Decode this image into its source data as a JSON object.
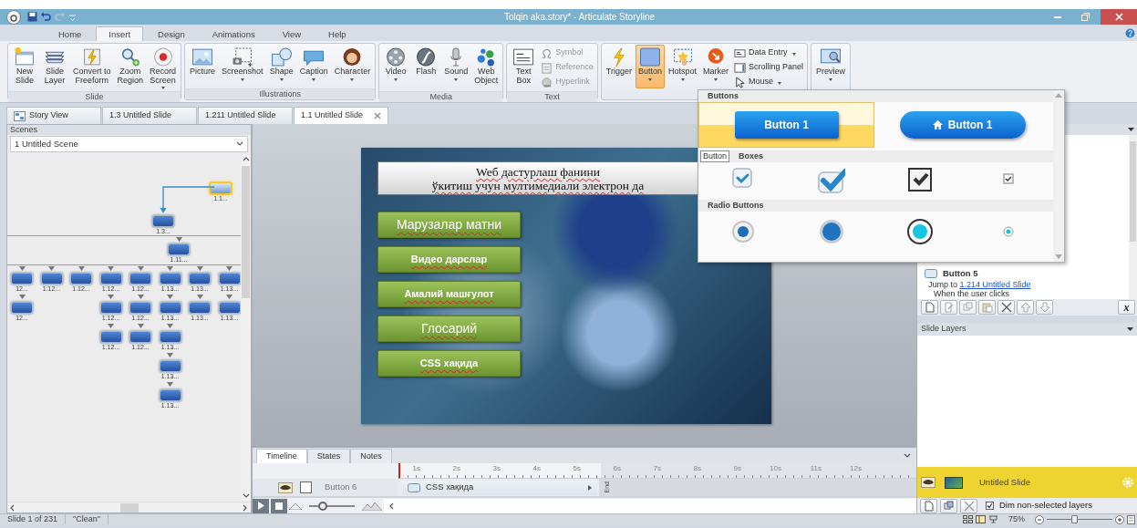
{
  "window": {
    "title": "Tolqin aka.story* - Articulate Storyline"
  },
  "menu_tabs": [
    {
      "label": "Home",
      "selected": false
    },
    {
      "label": "Insert",
      "selected": true
    },
    {
      "label": "Design",
      "selected": false
    },
    {
      "label": "Animations",
      "selected": false
    },
    {
      "label": "View",
      "selected": false
    },
    {
      "label": "Help",
      "selected": false
    }
  ],
  "ribbon_groups": [
    {
      "label": "Slide",
      "items": [
        {
          "kind": "large",
          "label": "New\nSlide",
          "dropdown": false,
          "selected": false,
          "disabled": false
        },
        {
          "kind": "large",
          "label": "Slide\nLayer",
          "dropdown": false,
          "selected": false,
          "disabled": false
        },
        {
          "kind": "large",
          "label": "Convert to\nFreeform",
          "dropdown": false,
          "selected": false,
          "disabled": false
        },
        {
          "kind": "large",
          "label": "Zoom\nRegion",
          "dropdown": false,
          "selected": false,
          "disabled": false
        },
        {
          "kind": "large",
          "label": "Record\nScreen",
          "dropdown": true,
          "selected": false,
          "disabled": false
        }
      ]
    },
    {
      "label": "Illustrations",
      "items": [
        {
          "kind": "large",
          "label": "Picture",
          "dropdown": false,
          "selected": false,
          "disabled": false
        },
        {
          "kind": "large",
          "label": "Screenshot",
          "dropdown": true,
          "selected": false,
          "disabled": false
        },
        {
          "kind": "large",
          "label": "Shape",
          "dropdown": true,
          "selected": false,
          "disabled": false
        },
        {
          "kind": "large",
          "label": "Caption",
          "dropdown": true,
          "selected": false,
          "disabled": false
        },
        {
          "kind": "large",
          "label": "Character",
          "dropdown": true,
          "selected": false,
          "disabled": false
        }
      ]
    },
    {
      "label": "Media",
      "items": [
        {
          "kind": "large",
          "label": "Video",
          "dropdown": true,
          "selected": false,
          "disabled": false
        },
        {
          "kind": "large",
          "label": "Flash",
          "dropdown": false,
          "selected": false,
          "disabled": false
        },
        {
          "kind": "large",
          "label": "Sound",
          "dropdown": true,
          "selected": false,
          "disabled": false
        },
        {
          "kind": "large",
          "label": "Web\nObject",
          "dropdown": false,
          "selected": false,
          "disabled": false
        }
      ]
    },
    {
      "label": "Text",
      "items": [
        {
          "kind": "large",
          "label": "Text\nBox",
          "dropdown": false,
          "selected": false,
          "disabled": false
        },
        {
          "kind": "small",
          "label": "Symbol",
          "dropdown": false,
          "selected": false,
          "disabled": true
        },
        {
          "kind": "small",
          "label": "Reference",
          "dropdown": false,
          "selected": false,
          "disabled": true
        },
        {
          "kind": "small",
          "label": "Hyperlink",
          "dropdown": false,
          "selected": false,
          "disabled": true
        }
      ]
    },
    {
      "items": [
        {
          "kind": "large",
          "label": "Trigger",
          "dropdown": false,
          "selected": false,
          "disabled": false
        },
        {
          "kind": "large",
          "label": "Button",
          "dropdown": true,
          "selected": true,
          "disabled": false
        },
        {
          "kind": "large",
          "label": "Hotspot",
          "dropdown": true,
          "selected": false,
          "disabled": false
        },
        {
          "kind": "large",
          "label": "Marker",
          "dropdown": true,
          "selected": false,
          "disabled": false
        },
        {
          "kind": "small",
          "label": "Data Entry",
          "dropdown": true,
          "selected": false,
          "disabled": false
        },
        {
          "kind": "small",
          "label": "Scrolling Panel",
          "dropdown": false,
          "selected": false,
          "disabled": false
        },
        {
          "kind": "small",
          "label": "Mouse",
          "dropdown": true,
          "selected": false,
          "disabled": false
        }
      ]
    },
    {
      "items": [
        {
          "kind": "large",
          "label": "Preview",
          "dropdown": true,
          "selected": false,
          "disabled": false
        }
      ]
    }
  ],
  "doc_tabs": [
    {
      "label": "Story View",
      "kind": "story",
      "selected": false
    },
    {
      "label": "1.3 Untitled Slide",
      "kind": "slide",
      "selected": false
    },
    {
      "label": "1.211 Untitled Slide",
      "kind": "slide",
      "selected": false
    },
    {
      "label": "1.1 Untitled Slide",
      "kind": "slide",
      "selected": true
    }
  ],
  "scenes": {
    "header": "Scenes",
    "scene": "1 Untitled Scene",
    "map": {
      "label": "1.1...",
      "selected": true,
      "children": [
        {
          "label": "1.3...",
          "selected": false,
          "children": [
            {
              "label": "1.11...",
              "selected": false,
              "children": [
                {
                  "label": "12...",
                  "selected": false,
                  "children": [
                    {
                      "label": "12...",
                      "selected": false
                    }
                  ]
                },
                {
                  "label": "1.12...",
                  "selected": false
                },
                {
                  "label": "1.12...",
                  "selected": false
                },
                {
                  "label": "1.12...",
                  "selected": false,
                  "children": [
                    {
                      "label": "1.12...",
                      "selected": false,
                      "children": [
                        {
                          "label": "1.12...",
                          "selected": false
                        }
                      ]
                    }
                  ]
                },
                {
                  "label": "1.12...",
                  "selected": false,
                  "children": [
                    {
                      "label": "1.12...",
                      "selected": false,
                      "children": [
                        {
                          "label": "1.12...",
                          "selected": false
                        }
                      ]
                    }
                  ]
                },
                {
                  "label": "1.13...",
                  "selected": false,
                  "children": [
                    {
                      "label": "1.13...",
                      "selected": false,
                      "children": [
                        {
                          "label": "1.13...",
                          "selected": false,
                          "children": [
                            {
                              "label": "1.13...",
                              "selected": false,
                              "children": [
                                {
                                  "label": "1.13...",
                                  "selected": false
                                }
                              ]
                            }
                          ]
                        }
                      ]
                    }
                  ]
                },
                {
                  "label": "1.13...",
                  "selected": false,
                  "children": [
                    {
                      "label": "1.13...",
                      "selected": false
                    }
                  ]
                },
                {
                  "label": "1.13...",
                  "selected": false,
                  "children": [
                    {
                      "label": "1.13...",
                      "selected": false
                    }
                  ]
                }
              ]
            }
          ]
        }
      ]
    }
  },
  "slide": {
    "title": "Weб дастурлаш фанини\nўкитиш учун мултимедиали электрон да",
    "buttons": [
      {
        "label": "Марузалар матни",
        "kind": "plain"
      },
      {
        "label": "Видео дарслар",
        "kind": "bold"
      },
      {
        "label": "Амалий машғулот",
        "kind": "bold"
      },
      {
        "label": "Глосарий",
        "kind": "plain"
      },
      {
        "label": "CSS хақида",
        "kind": "bold"
      }
    ]
  },
  "gallery": {
    "sections": [
      {
        "title": "Buttons",
        "kind": "buttons",
        "items": [
          {
            "label": "Button 1",
            "selected": true
          },
          {
            "label": "Button 1",
            "selected": false
          }
        ]
      },
      {
        "title": "Boxes",
        "tooltip": "Button",
        "kind": "checkboxes",
        "items": [
          {
            "checked": true
          },
          {
            "checked": true
          },
          {
            "checked": true
          },
          {
            "checked": true
          }
        ]
      },
      {
        "title": "Radio Buttons",
        "kind": "radios",
        "items": [
          {
            "checked": true
          },
          {
            "checked": true
          },
          {
            "checked": true
          },
          {
            "checked": true
          }
        ]
      }
    ]
  },
  "triggers": {
    "items": [
      {
        "object": "Button 5",
        "action": "Jump to",
        "target": "1.214 Untitled Slide",
        "condition": "When the user clicks"
      }
    ],
    "variables": "x"
  },
  "layers": {
    "header": "Slide Layers",
    "items": [
      {
        "name": "Untitled Slide",
        "selected": true,
        "visible": true
      }
    ],
    "dim": {
      "label": "Dim non-selected layers",
      "checked": true
    }
  },
  "timeline": {
    "tabs": [
      {
        "label": "Timeline",
        "selected": true
      },
      {
        "label": "States",
        "selected": false
      },
      {
        "label": "Notes",
        "selected": false
      }
    ],
    "ruler": [
      "1s",
      "2s",
      "3s",
      "4s",
      "5s",
      "6s",
      "7s",
      "8s",
      "9s",
      "10s",
      "11s",
      "12s"
    ],
    "rows": [
      {
        "name": "Button 6",
        "visible": true,
        "locked": false,
        "object": "CSS хақида"
      }
    ],
    "end_label": "End",
    "zoom": {
      "level": 0.3
    }
  },
  "status_bar": {
    "slide": "Slide 1 of 231",
    "theme": "\"Clean\"",
    "zoom": "75%",
    "zoom_slider": {
      "level": 0.42
    }
  }
}
